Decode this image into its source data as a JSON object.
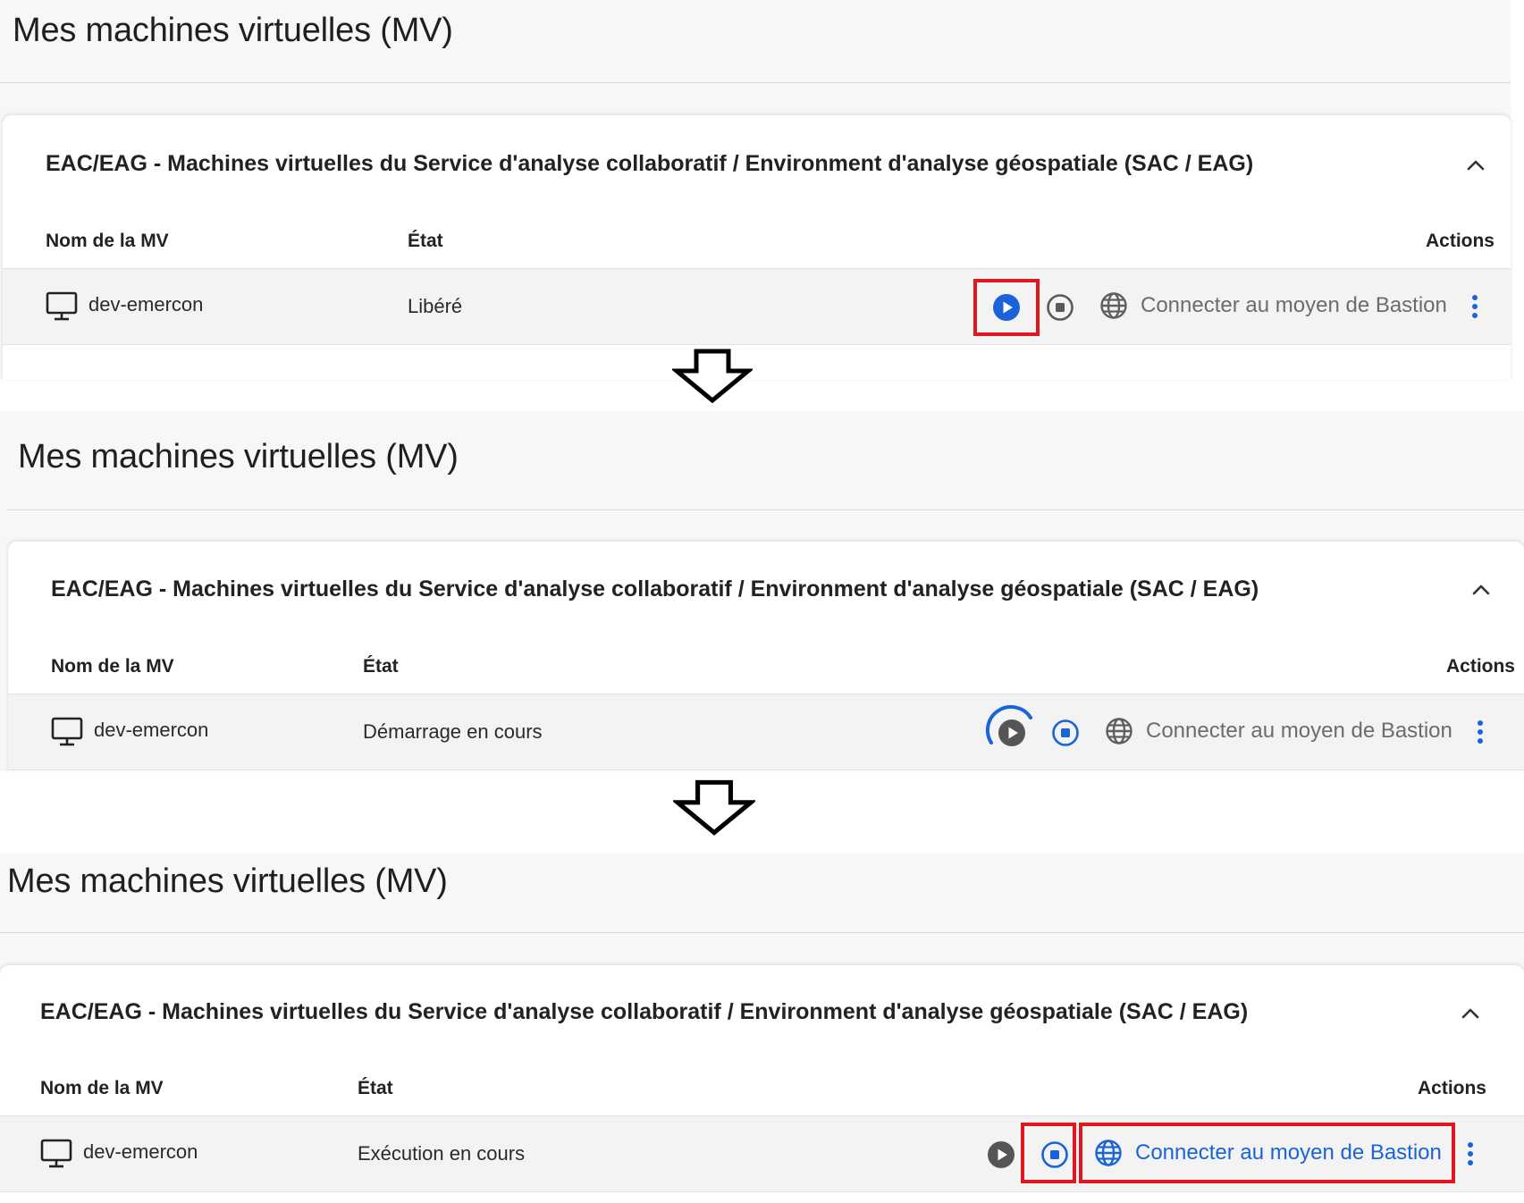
{
  "panels": [
    {
      "page_title": "Mes machines virtuelles (MV)",
      "card_title": "EAC/EAG - Machines virtuelles du Service d'analyse collaboratif / Environment d'analyse géospatiale (SAC / EAG)",
      "columns": {
        "name": "Nom de la MV",
        "state": "État",
        "actions": "Actions"
      },
      "vm": {
        "name": "dev-emercon",
        "state": "Libéré"
      },
      "bastion_label": "Connecter au moyen de Bastion",
      "start_button": "active",
      "stop_button": "disabled",
      "bastion_button": "disabled",
      "highlighted": [
        "start-button"
      ]
    },
    {
      "page_title": "Mes machines virtuelles (MV)",
      "card_title": "EAC/EAG - Machines virtuelles du Service d'analyse collaboratif / Environment d'analyse géospatiale (SAC / EAG)",
      "columns": {
        "name": "Nom de la MV",
        "state": "État",
        "actions": "Actions"
      },
      "vm": {
        "name": "dev-emercon",
        "state": "Démarrage en cours"
      },
      "bastion_label": "Connecter au moyen de Bastion",
      "start_button": "loading",
      "stop_button": "active",
      "bastion_button": "disabled",
      "highlighted": []
    },
    {
      "page_title": "Mes machines virtuelles (MV)",
      "card_title": "EAC/EAG - Machines virtuelles du Service d'analyse collaboratif / Environment d'analyse géospatiale (SAC / EAG)",
      "columns": {
        "name": "Nom de la MV",
        "state": "État",
        "actions": "Actions"
      },
      "vm": {
        "name": "dev-emercon",
        "state": "Exécution en cours"
      },
      "bastion_label": "Connecter au moyen de Bastion",
      "start_button": "disabled",
      "stop_button": "active",
      "bastion_button": "active",
      "highlighted": [
        "stop-button",
        "bastion-button"
      ]
    }
  ],
  "icons": {
    "vm": "monitor-icon",
    "start": "play-circle-icon",
    "stop": "stop-circle-icon",
    "bastion": "globe-icon",
    "more": "kebab-menu-icon",
    "collapse": "chevron-up-icon",
    "transition": "down-arrow-icon"
  },
  "colors": {
    "accent": "#1a63d9",
    "disabled": "#6c6c6c",
    "highlight": "#e0161e",
    "row_bg": "#f3f3f4",
    "page_bg": "#f7f7f7"
  }
}
